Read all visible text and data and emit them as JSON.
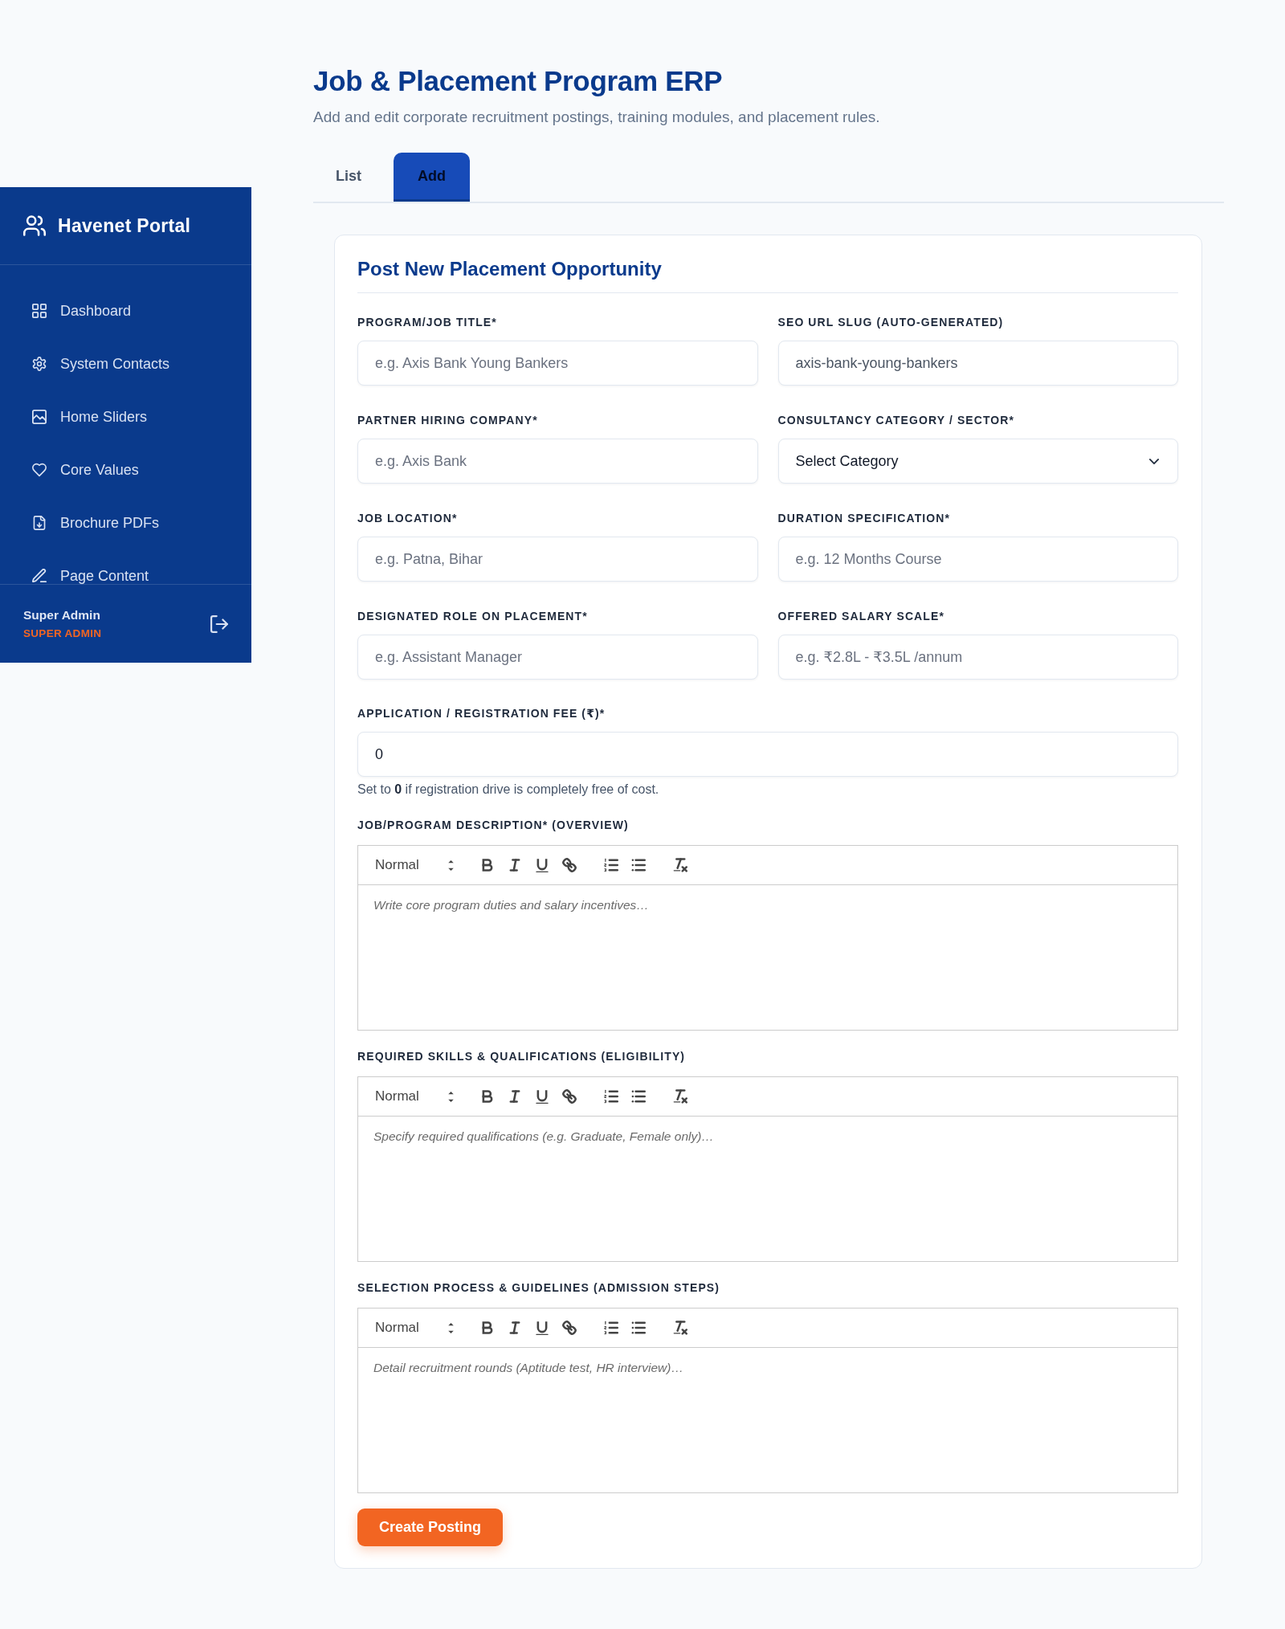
{
  "sidebar": {
    "brand": "Havenet Portal",
    "items": [
      {
        "label": "Dashboard",
        "selected": false
      },
      {
        "label": "System Contacts",
        "selected": false
      },
      {
        "label": "Home Sliders",
        "selected": false
      },
      {
        "label": "Core Values",
        "selected": false
      },
      {
        "label": "Brochure PDFs",
        "selected": false
      },
      {
        "label": "Page Content",
        "selected": false
      }
    ],
    "user": {
      "name": "Super Admin",
      "role": "SUPER ADMIN"
    }
  },
  "header": {
    "title": "Job & Placement Program ERP",
    "subtitle": "Add and edit corporate recruitment postings, training modules, and placement rules."
  },
  "tabs": [
    {
      "label": "List",
      "selected": false
    },
    {
      "label": "Add",
      "selected": true
    }
  ],
  "form": {
    "title": "Post New Placement Opportunity",
    "fields": [
      {
        "kind": "text",
        "label": "PROGRAM/JOB TITLE*",
        "placeholder": "e.g. Axis Bank Young Bankers",
        "readonly": false
      },
      {
        "kind": "text",
        "label": "SEO URL SLUG (AUTO-GENERATED)",
        "value": "axis-bank-young-bankers",
        "readonly": true
      },
      {
        "kind": "text",
        "label": "PARTNER HIRING COMPANY*",
        "placeholder": "e.g. Axis Bank",
        "readonly": false
      },
      {
        "kind": "select",
        "label": "CONSULTANCY CATEGORY / SECTOR*",
        "value": "Select Category"
      },
      {
        "kind": "text",
        "label": "JOB LOCATION*",
        "placeholder": "e.g. Patna, Bihar",
        "readonly": false
      },
      {
        "kind": "text",
        "label": "DURATION SPECIFICATION*",
        "placeholder": "e.g. 12 Months Course",
        "readonly": false
      },
      {
        "kind": "text",
        "label": "DESIGNATED ROLE ON PLACEMENT*",
        "placeholder": "e.g. Assistant Manager",
        "readonly": false
      },
      {
        "kind": "text",
        "label": "OFFERED SALARY SCALE*",
        "placeholder": "e.g. ₹2.8L - ₹3.5L /annum",
        "readonly": false
      }
    ],
    "fee": {
      "label": "APPLICATION / REGISTRATION FEE (₹)*",
      "value": "0",
      "readonly": false,
      "help": "Set to **0** if registration drive is completely free of cost."
    },
    "editors": [
      {
        "label": "JOB/PROGRAM DESCRIPTION* (OVERVIEW)",
        "format": "Normal",
        "placeholder": "Write core program duties and salary incentives…"
      },
      {
        "label": "REQUIRED SKILLS & QUALIFICATIONS (ELIGIBILITY)",
        "format": "Normal",
        "placeholder": "Specify required qualifications (e.g. Graduate, Female only)…"
      },
      {
        "label": "SELECTION PROCESS & GUIDELINES (ADMISSION STEPS)",
        "format": "Normal",
        "placeholder": "Detail recruitment rounds (Aptitude test, HR interview)…"
      }
    ],
    "submit": {
      "label": "Create Posting"
    }
  }
}
